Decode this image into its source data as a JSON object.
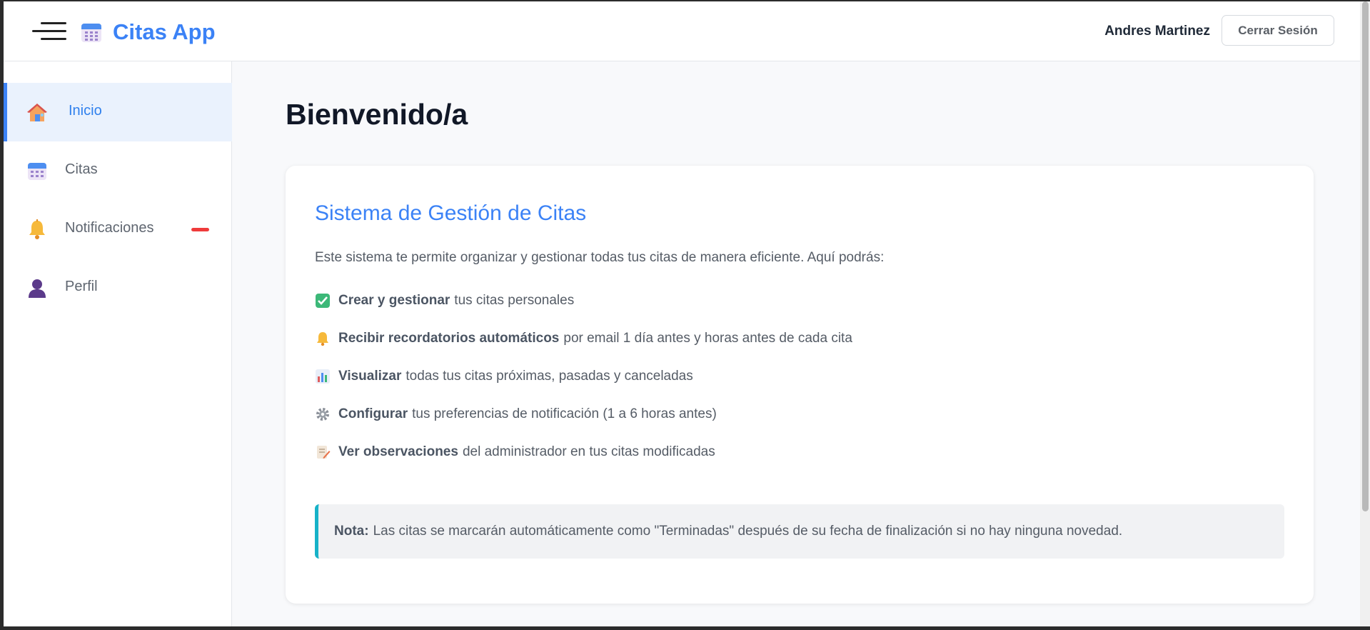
{
  "header": {
    "app_name": "Citas App",
    "user_name": "Andres Martinez",
    "logout_label": "Cerrar Sesión"
  },
  "sidebar": {
    "items": [
      {
        "label": "Inicio",
        "icon": "home-icon",
        "active": true
      },
      {
        "label": "Citas",
        "icon": "calendar-icon",
        "active": false
      },
      {
        "label": "Notificaciones",
        "icon": "bell-icon",
        "active": false,
        "badge": true
      },
      {
        "label": "Perfil",
        "icon": "user-icon",
        "active": false
      }
    ]
  },
  "main": {
    "title": "Bienvenido/a",
    "card": {
      "title": "Sistema de Gestión de Citas",
      "intro": "Este sistema te permite organizar y gestionar todas tus citas de manera eficiente. Aquí podrás:",
      "features": [
        {
          "icon": "check-icon",
          "bold": "Crear y gestionar",
          "text": "tus citas personales"
        },
        {
          "icon": "bell-icon",
          "bold": "Recibir recordatorios automáticos",
          "text": "por email 1 día antes y horas antes de cada cita"
        },
        {
          "icon": "chart-icon",
          "bold": "Visualizar",
          "text": "todas tus citas próximas, pasadas y canceladas"
        },
        {
          "icon": "gear-icon",
          "bold": "Configurar",
          "text": "tus preferencias de notificación (1 a 6 horas antes)"
        },
        {
          "icon": "memo-icon",
          "bold": "Ver observaciones",
          "text": "del administrador en tus citas modificadas"
        }
      ],
      "note_label": "Nota:",
      "note_text": "Las citas se marcarán automáticamente como \"Terminadas\" después de su fecha de finalización si no hay ninguna novedad."
    }
  },
  "colors": {
    "accent": "#3b82f6",
    "badge": "#ef3b3b",
    "note_border": "#17b2c8"
  }
}
